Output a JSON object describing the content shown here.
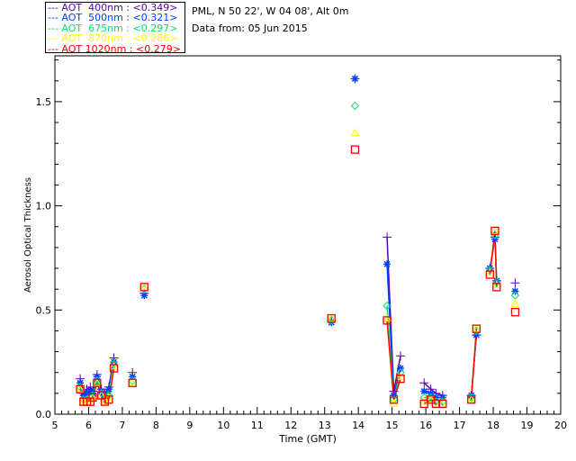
{
  "header": {
    "location": "PML, N 50 22', W 04 08', Alt 0m",
    "date": "Data from: 05 Jun 2015"
  },
  "chart_data": {
    "type": "scatter",
    "xlabel": "Time (GMT)",
    "ylabel": "Aerosol Optical Thickness",
    "xlim": [
      5,
      20
    ],
    "ylim": [
      0,
      1.72
    ],
    "xticks": [
      5,
      6,
      7,
      8,
      9,
      10,
      11,
      12,
      13,
      14,
      15,
      16,
      17,
      18,
      19,
      20
    ],
    "yticks": [
      0.0,
      0.5,
      1.0,
      1.5
    ],
    "ytick_labels": [
      "0.0",
      "0.5",
      "1.0",
      "1.5"
    ],
    "legend_placement": "top-left, outside plot",
    "x": [
      5.75,
      5.85,
      5.95,
      6.05,
      6.12,
      6.25,
      6.38,
      6.48,
      6.6,
      6.75,
      7.3,
      7.65,
      13.2,
      13.9,
      14.85,
      15.05,
      15.25,
      15.95,
      16.15,
      16.3,
      16.5,
      17.35,
      17.5,
      17.9,
      18.05,
      18.1,
      18.65
    ],
    "series": [
      {
        "name": "AOT  400nm : <0.349>",
        "color": "#5a00b4",
        "marker": "plus",
        "values": [
          0.17,
          0.1,
          0.12,
          0.13,
          0.11,
          0.19,
          0.12,
          0.1,
          0.13,
          0.27,
          0.2,
          0.58,
          0.45,
          1.61,
          0.85,
          0.11,
          0.28,
          0.15,
          0.12,
          0.1,
          0.09,
          0.09,
          0.38,
          0.7,
          0.85,
          0.64,
          0.63
        ]
      },
      {
        "name": "AOT  500nm : <0.321>",
        "color": "#0040ff",
        "marker": "asterisk",
        "values": [
          0.15,
          0.09,
          0.1,
          0.11,
          0.1,
          0.18,
          0.11,
          0.09,
          0.12,
          0.25,
          0.18,
          0.57,
          0.44,
          1.61,
          0.72,
          0.09,
          0.22,
          0.11,
          0.1,
          0.08,
          0.08,
          0.09,
          0.38,
          0.7,
          0.84,
          0.64,
          0.59
        ]
      },
      {
        "name": "AOT  675nm : <0.297>",
        "color": "#00e070",
        "marker": "diamond",
        "values": [
          0.13,
          0.07,
          0.07,
          0.08,
          0.09,
          0.16,
          0.1,
          0.07,
          0.09,
          0.24,
          0.16,
          0.6,
          0.45,
          1.48,
          0.52,
          0.07,
          0.2,
          0.08,
          0.08,
          0.06,
          0.06,
          0.08,
          0.4,
          0.69,
          0.86,
          0.63,
          0.57
        ]
      },
      {
        "name": "AOT  870nm : <0.286>",
        "color": "#ffff00",
        "marker": "triangle",
        "values": [
          0.12,
          0.06,
          0.06,
          0.07,
          0.08,
          0.15,
          0.09,
          0.06,
          0.08,
          0.23,
          0.15,
          0.61,
          0.46,
          1.35,
          0.46,
          0.05,
          0.18,
          0.06,
          0.07,
          0.05,
          0.05,
          0.07,
          0.41,
          0.68,
          0.88,
          0.62,
          0.53
        ]
      },
      {
        "name": "AOT 1020nm : <0.279>",
        "color": "#ff0000",
        "marker": "square",
        "values": [
          0.12,
          0.06,
          0.06,
          0.06,
          0.08,
          0.15,
          0.09,
          0.06,
          0.07,
          0.22,
          0.15,
          0.61,
          0.46,
          1.27,
          0.45,
          0.07,
          0.17,
          0.05,
          0.07,
          0.05,
          0.05,
          0.07,
          0.41,
          0.67,
          0.88,
          0.61,
          0.49
        ]
      }
    ]
  }
}
